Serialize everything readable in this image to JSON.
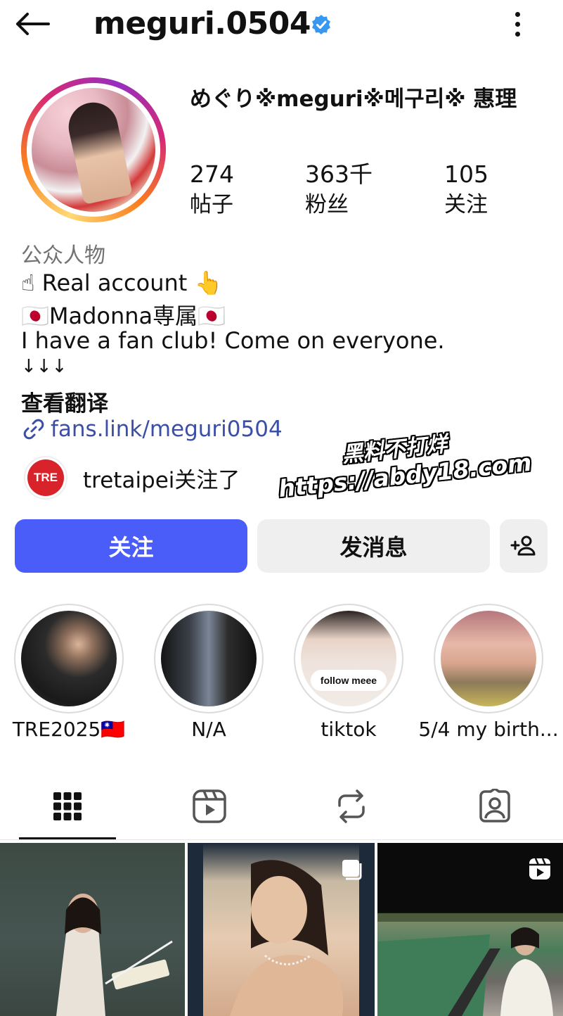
{
  "header": {
    "username": "meguri.0504"
  },
  "profile": {
    "display_name": "めぐり※meguri※메구리※ 惠理",
    "stats": [
      {
        "value": "274",
        "label": "帖子"
      },
      {
        "value": "363千",
        "label": "粉丝"
      },
      {
        "value": "105",
        "label": "关注"
      }
    ],
    "category": "公众人物",
    "bio": [
      "☝ Real account 👆",
      "🇯🇵Madonna専属🇯🇵",
      "I have a fan club! Come on everyone.",
      "↓↓↓"
    ],
    "translate_label": "查看翻译",
    "link": "fans.link/meguri0504",
    "followed_by": "tretaipei关注了",
    "followed_by_logo_text": "TRE"
  },
  "watermark": {
    "line1": "黑料不打烊",
    "line2": "https://abdy18.com"
  },
  "actions": {
    "follow_label": "关注",
    "message_label": "发消息"
  },
  "highlights": [
    {
      "label": "TRE2025🇹🇼"
    },
    {
      "label": "N/A"
    },
    {
      "label": "tiktok",
      "sticker": "follow meee"
    },
    {
      "label": "5/4 my birth..."
    }
  ],
  "colors": {
    "accent": "#4a5df9",
    "link": "#3b4fa8",
    "verified": "#3897f0"
  },
  "icons": {
    "back": "arrow-left-icon",
    "more": "more-vertical-icon",
    "verified": "verified-badge-icon",
    "link": "link-icon",
    "add_user": "add-user-icon",
    "tabs": [
      "grid-icon",
      "reels-icon",
      "reposts-icon",
      "tagged-icon"
    ]
  }
}
